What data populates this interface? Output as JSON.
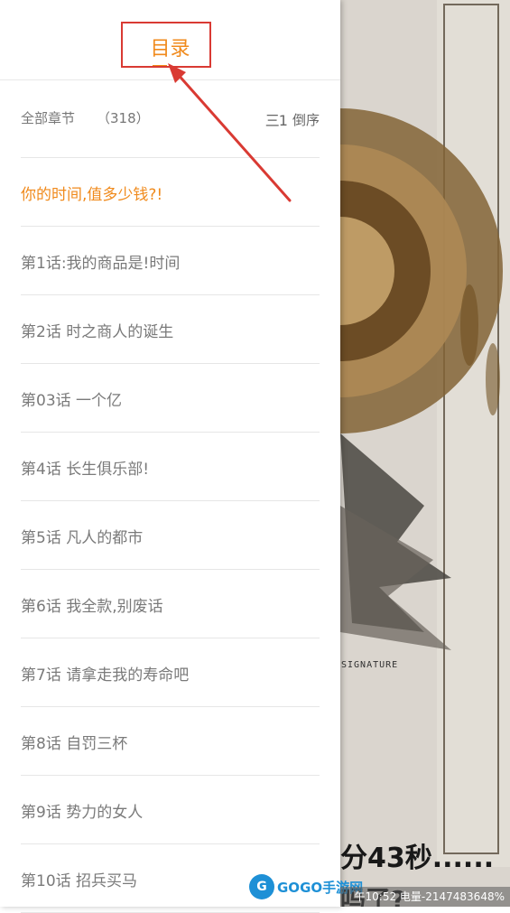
{
  "drawer": {
    "title": "目录",
    "summary_label": "全部章节",
    "summary_count": "（318）",
    "sort_icon": "三1",
    "sort_label": "倒序"
  },
  "chapters": [
    {
      "label": "你的时间,值多少钱?!",
      "current": true
    },
    {
      "label": "第1话:我的商品是!时间",
      "current": false
    },
    {
      "label": "第2话 时之商人的诞生",
      "current": false
    },
    {
      "label": "第03话 一个亿",
      "current": false
    },
    {
      "label": "第4话 长生俱乐部!",
      "current": false
    },
    {
      "label": "第5话 凡人的都市",
      "current": false
    },
    {
      "label": "第6话 我全款,别废话",
      "current": false
    },
    {
      "label": "第7话 请拿走我的寿命吧",
      "current": false
    },
    {
      "label": "第8话 自罚三杯",
      "current": false
    },
    {
      "label": "第9话 势力的女人",
      "current": false
    },
    {
      "label": "第10话 招兵买马",
      "current": false
    }
  ],
  "comic": {
    "signature": "SIGNATURE",
    "caption": "分43秒......",
    "caption2": "吗了?"
  },
  "status": "午10:52 电量-2147483648%",
  "watermark": {
    "logo": "G",
    "text": "GOGO手游网"
  },
  "colors": {
    "accent": "#f08a1c",
    "annotation": "#d93a33"
  }
}
